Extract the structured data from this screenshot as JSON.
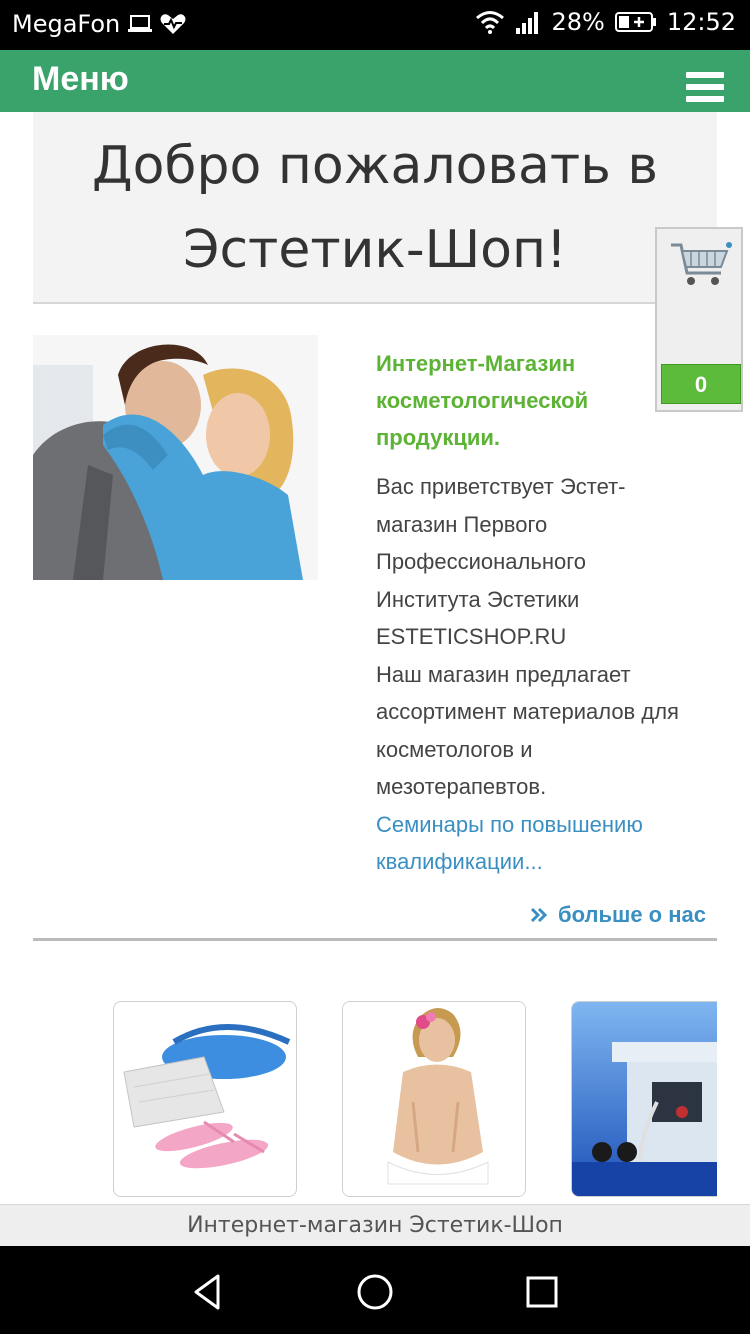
{
  "status_bar": {
    "carrier": "MegaFon",
    "battery_percent": "28%",
    "time": "12:52",
    "icons": [
      "laptop-icon",
      "heart-icon",
      "wifi-icon",
      "signal-icon",
      "battery-icon"
    ]
  },
  "menu_bar": {
    "title": "Меню"
  },
  "welcome": {
    "line1": "Добро пожаловать в",
    "line2": "Эстетик-Шоп!"
  },
  "intro": {
    "heading": "Интернет-Магазин косметологической продукции.",
    "paragraph1": "Вас приветствует Эстет-магазин Первого Профессионального Института Эстетики ESTETICSHOP.RU",
    "paragraph2": "Наш магазин предлагает ассортимент материалов для косметологов и мезотерапевтов.",
    "link": "Семинары по повышению квалификации..."
  },
  "more_link": "больше о нас",
  "cart": {
    "count": "0"
  },
  "products": [
    "disposable-supplies",
    "body-care",
    "laser-equipment"
  ],
  "footer": {
    "text": "Интернет-магазин Эстетик-Шоп"
  },
  "colors": {
    "menu_green": "#3aa36b",
    "heading_green": "#5cb335",
    "link_blue": "#3a8fc2",
    "cart_green": "#5dbb3c"
  }
}
